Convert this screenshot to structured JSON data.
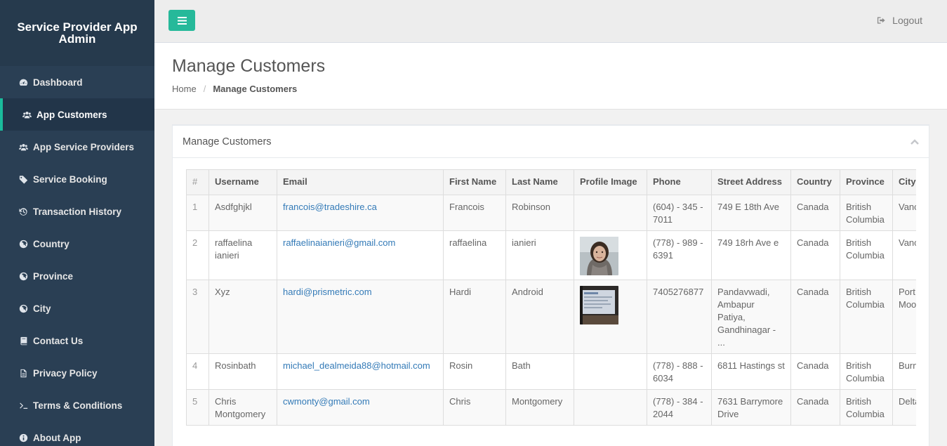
{
  "app": {
    "title": "Service Provider App Admin"
  },
  "sidebar": {
    "items": [
      {
        "label": "Dashboard",
        "icon": "dashboard-icon"
      },
      {
        "label": "App Customers",
        "icon": "users-icon",
        "active": true
      },
      {
        "label": "App Service Providers",
        "icon": "users-icon"
      },
      {
        "label": "Service Booking",
        "icon": "tag-icon"
      },
      {
        "label": "Transaction History",
        "icon": "history-icon"
      },
      {
        "label": "Country",
        "icon": "globe-icon"
      },
      {
        "label": "Province",
        "icon": "globe-icon"
      },
      {
        "label": "City",
        "icon": "globe-icon"
      },
      {
        "label": "Contact Us",
        "icon": "book-icon"
      },
      {
        "label": "Privacy Policy",
        "icon": "file-icon"
      },
      {
        "label": "Terms & Conditions",
        "icon": "terminal-icon"
      },
      {
        "label": "About App",
        "icon": "info-icon"
      }
    ]
  },
  "topbar": {
    "logout_label": "Logout"
  },
  "header": {
    "title": "Manage Customers",
    "breadcrumb": {
      "home": "Home",
      "current": "Manage Customers"
    }
  },
  "panel": {
    "title": "Manage Customers",
    "table": {
      "columns": [
        "#",
        "Username",
        "Email",
        "First Name",
        "Last Name",
        "Profile Image",
        "Phone",
        "Street Address",
        "Country",
        "Province",
        "City"
      ],
      "rows": [
        {
          "num": "1",
          "username": "Asdfghjkl",
          "email": "francois@tradeshire.ca",
          "first_name": "Francois",
          "last_name": "Robinson",
          "profile_image": "",
          "phone": "(604) - 345 - 7011",
          "street": "749 E 18th Ave",
          "country": "Canada",
          "province": "British Columbia",
          "city": "Vancouver"
        },
        {
          "num": "2",
          "username": "raffaelina ianieri",
          "email": "raffaelinaianieri@gmail.com",
          "first_name": "raffaelina",
          "last_name": "ianieri",
          "profile_image": "woman-photo",
          "phone": "(778) - 989 - 6391",
          "street": "749 18rh Ave e",
          "country": "Canada",
          "province": "British Columbia",
          "city": "Vancouver"
        },
        {
          "num": "3",
          "username": "Xyz",
          "email": "hardi@prismetric.com",
          "first_name": "Hardi",
          "last_name": "Android",
          "profile_image": "screen-photo",
          "phone": "7405276877",
          "street": "Pandavwadi, Ambapur Patiya, Gandhinagar - ...",
          "country": "Canada",
          "province": "British Columbia",
          "city": "Port Moody"
        },
        {
          "num": "4",
          "username": "Rosinbath",
          "email": "michael_dealmeida88@hotmail.com",
          "first_name": "Rosin",
          "last_name": "Bath",
          "profile_image": "",
          "phone": "(778) - 888 - 6034",
          "street": "6811 Hastings st",
          "country": "Canada",
          "province": "British Columbia",
          "city": "Burnaby"
        },
        {
          "num": "5",
          "username": "Chris Montgomery",
          "email": "cwmonty@gmail.com",
          "first_name": "Chris",
          "last_name": "Montgomery",
          "profile_image": "",
          "phone": "(778) - 384 - 2044",
          "street": "7631 Barrymore Drive",
          "country": "Canada",
          "province": "British Columbia",
          "city": "Delta"
        }
      ]
    }
  },
  "colors": {
    "sidebar_bg": "#2a3f54",
    "accent": "#1abb9c",
    "link": "#337ab7"
  }
}
